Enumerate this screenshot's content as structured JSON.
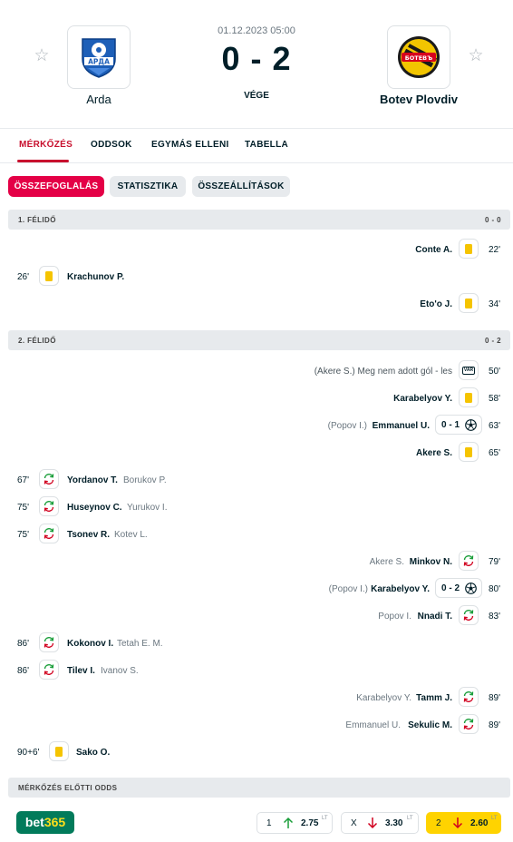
{
  "match": {
    "datetime": "01.12.2023 05:00",
    "score": "0 - 2",
    "status": "VÉGE",
    "home": {
      "name": "Arda",
      "logo_text": "АРДА"
    },
    "away": {
      "name": "Botev Plovdiv",
      "logo_text": "БОТЕВЪ"
    }
  },
  "tabs": [
    "MÉRKŐZÉS",
    "ODDSOK",
    "EGYMÁS ELLENI",
    "TABELLA"
  ],
  "subtabs": [
    "ÖSSZEFOGLALÁS",
    "STATISZTIKA",
    "ÖSSZEÁLLÍTÁSOK"
  ],
  "half1": {
    "label": "1. FÉLIDŐ",
    "score": "0 - 0"
  },
  "half2": {
    "label": "2. FÉLIDŐ",
    "score": "0 - 2"
  },
  "events": [
    {
      "time": "22'",
      "player": "Conte A."
    },
    {
      "time": "26'",
      "player": "Krachunov P."
    },
    {
      "time": "34'",
      "player": "Eto'o J."
    },
    {
      "time": "50'",
      "note": "(Akere S.) Meg nem adott gól - les"
    },
    {
      "time": "58'",
      "player": "Karabelyov Y."
    },
    {
      "time": "63'",
      "player": "Emmanuel U.",
      "assist": "(Popov I.)",
      "score": "0 - 1"
    },
    {
      "time": "65'",
      "player": "Akere S."
    },
    {
      "time": "67'",
      "player": "Yordanov T.",
      "sub": "Borukov P."
    },
    {
      "time": "75'",
      "player": "Huseynov C.",
      "sub": "Yurukov I."
    },
    {
      "time": "75'",
      "player": "Tsonev R.",
      "sub": "Kotev L."
    },
    {
      "time": "79'",
      "player": "Minkov N.",
      "sub": "Akere S."
    },
    {
      "time": "80'",
      "player": "Karabelyov Y.",
      "assist": "(Popov I.)",
      "score": "0 - 2"
    },
    {
      "time": "83'",
      "player": "Nnadi T.",
      "sub": "Popov I."
    },
    {
      "time": "86'",
      "player": "Kokonov I.",
      "sub": "Tetah E. M."
    },
    {
      "time": "86'",
      "player": "Tilev I.",
      "sub": "Ivanov S."
    },
    {
      "time": "89'",
      "player": "Tamm J.",
      "sub": "Karabelyov Y."
    },
    {
      "time": "89'",
      "player": "Sekulic M.",
      "sub": "Emmanuel U."
    },
    {
      "time": "90+6'",
      "player": "Sako O."
    }
  ],
  "odds": {
    "title": "MÉRKŐZÉS ELŐTTI ODDS",
    "bookmaker": {
      "part1": "bet",
      "part2": "365"
    },
    "items": [
      {
        "label": "1",
        "value": "2.75",
        "sup": "LT",
        "dir": "up"
      },
      {
        "label": "X",
        "value": "3.30",
        "sup": "LT",
        "dir": "down"
      },
      {
        "label": "2",
        "value": "2.60",
        "sup": "LT",
        "dir": "down"
      }
    ]
  },
  "icons": {
    "star": "star-icon",
    "yellow_card": "yellow-card-icon",
    "goal": "soccer-ball-icon",
    "substitution": "substitution-icon",
    "var": "var-icon",
    "arrow_up": "arrow-up-icon",
    "arrow_down": "arrow-down-icon"
  },
  "colors": {
    "accent": "#c8102e",
    "pill_active": "#e40046",
    "yellow_card": "#f5c400",
    "bet365": "#027b5b",
    "odds_highlight": "#ffd300",
    "arrow_up": "#1a9e3a",
    "arrow_down": "#d1001f"
  }
}
